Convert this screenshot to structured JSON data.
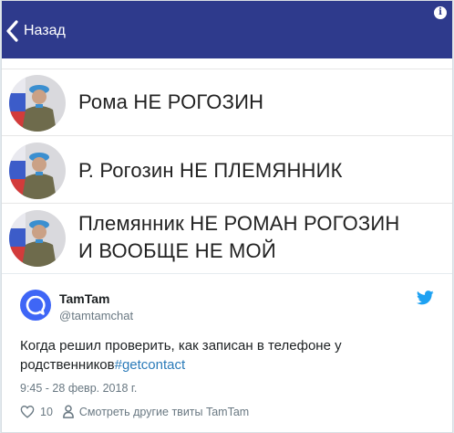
{
  "app": {
    "back_label": "Назад",
    "header_color": "#2e3a8c"
  },
  "contacts": [
    {
      "name": "Рома НЕ РОГОЗИН"
    },
    {
      "name": "Р. Рогозин НЕ ПЛЕМЯННИК"
    },
    {
      "name_line1": "Племянник НЕ РОМАН РОГОЗИН",
      "name_line2": "И ВООБЩЕ НЕ МОЙ"
    }
  ],
  "tweet": {
    "author_name": "TamTam",
    "author_handle": "@tamtamchat",
    "text": "Когда решил проверить, как записан в телефоне у родственников",
    "hashtag": "#getcontact",
    "timestamp": "9:45 - 28 февр. 2018 г.",
    "likes": "10",
    "more_link": "Смотреть другие твиты TamTam",
    "link_color": "#2b7bb9",
    "bird_color": "#1da1f2"
  }
}
